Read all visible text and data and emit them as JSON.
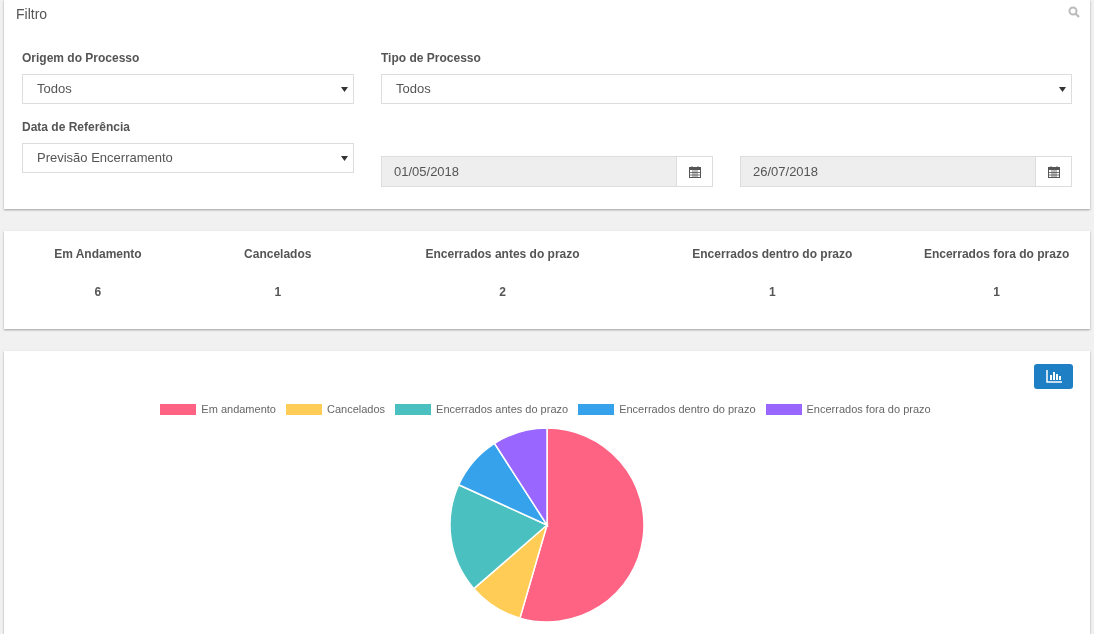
{
  "filter": {
    "title": "Filtro",
    "fields": [
      {
        "kind": "select",
        "label": "Origem do Processo",
        "value": "Todos"
      },
      {
        "kind": "wide_select",
        "label": "Tipo de Processo",
        "value": "Todos"
      },
      {
        "kind": "select",
        "label": "Data de Referência",
        "value": "Previsão Encerramento"
      },
      {
        "kind": "date",
        "value": "01/05/2018"
      },
      {
        "kind": "date",
        "value": "26/07/2018"
      }
    ]
  },
  "stats": [
    {
      "label": "Em Andamento",
      "value": "6"
    },
    {
      "label": "Cancelados",
      "value": "1"
    },
    {
      "label": "Encerrados antes do prazo",
      "value": "2"
    },
    {
      "label": "Encerrados dentro do prazo",
      "value": "1"
    },
    {
      "label": "Encerrados fora do prazo",
      "value": "1"
    }
  ],
  "chart": {
    "chart_data": {
      "type": "pie",
      "categories": [
        "Em andamento",
        "Cancelados",
        "Encerrados antes do prazo",
        "Encerrados dentro do prazo",
        "Encerrados fora do prazo"
      ],
      "values": [
        54.5,
        9.1,
        18.2,
        9.1,
        9.1
      ],
      "colors": [
        "#ff6384",
        "#ffcd56",
        "#4bc0c0",
        "#36a2eb",
        "#9966ff"
      ]
    }
  }
}
